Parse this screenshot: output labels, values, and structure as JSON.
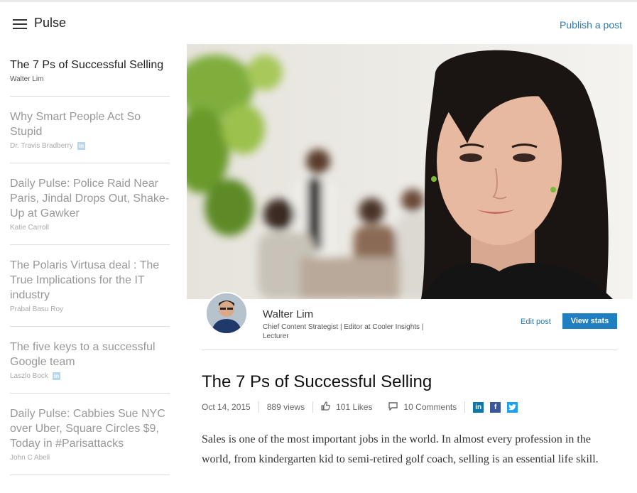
{
  "header": {
    "brand": "Pulse",
    "publish_label": "Publish a post",
    "menu_icon": "hamburger-menu-icon"
  },
  "sidebar": {
    "items": [
      {
        "title": "The 7 Ps of Successful Selling",
        "author": "Walter Lim",
        "badge": false
      },
      {
        "title": "Why Smart People Act So Stupid",
        "author": "Dr. Travis Bradberry",
        "badge": true
      },
      {
        "title": "Daily Pulse: Police Raid Near Paris, Jindal Drops Out, Shake-Up at Gawker",
        "author": "Katie Carroll",
        "badge": false
      },
      {
        "title": "The Polaris Virtusa deal : The True Implications for the IT industry",
        "author": "Prabal Basu Roy",
        "badge": false
      },
      {
        "title": "The five keys to a successful Google team",
        "author": "Laszlo Bock",
        "badge": true
      },
      {
        "title": "Daily Pulse: Cabbies Sue NYC over Uber, Square Circles $9, Today in #Parisattacks",
        "author": "John C Abell",
        "badge": false
      }
    ]
  },
  "author": {
    "name": "Walter Lim",
    "headline": "Chief Content Strategist | Editor at Cooler Insights | Lecturer",
    "edit_label": "Edit post",
    "stats_label": "View stats"
  },
  "post": {
    "title": "The 7 Ps of Successful Selling",
    "date": "Oct 14, 2015",
    "views": "889 views",
    "likes": "101 Likes",
    "comments": "10 Comments",
    "body": "Sales is one of the most important jobs in the world. In almost every profession in the world, from kindergarten kid to semi-retired golf coach, selling is an essential life skill."
  },
  "colors": {
    "link": "#2a7ab0",
    "button": "#1f7fc0",
    "linkedin": "#0e76a8",
    "facebook": "#3b5998",
    "twitter": "#1da1f2"
  }
}
